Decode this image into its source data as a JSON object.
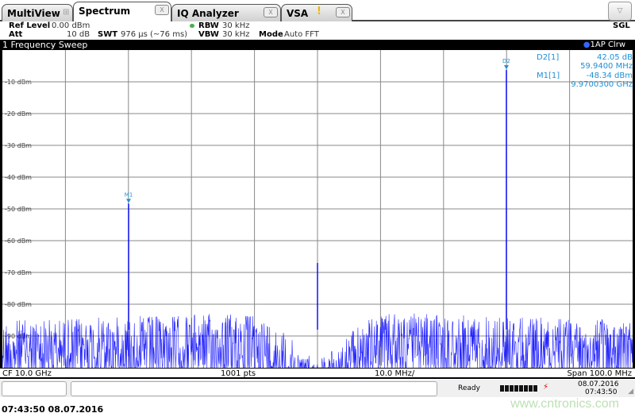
{
  "tabs": [
    {
      "label": "MultiView",
      "icon": "grid-icon"
    },
    {
      "label": "Spectrum",
      "close": "X",
      "active": true
    },
    {
      "label": "IQ Analyzer",
      "close": "X"
    },
    {
      "label": "VSA",
      "close": "X",
      "icon": "warning-icon"
    }
  ],
  "dropdown": "▽",
  "info": {
    "ref_level_label": "Ref Level",
    "ref_level": "0.00 dBm",
    "att_label": "Att",
    "att": "10 dB",
    "swt_label": "SWT",
    "swt": "976 µs (~76 ms)",
    "rbw_label": "RBW",
    "rbw": "30 kHz",
    "vbw_label": "VBW",
    "vbw": "30 kHz",
    "mode_label": "Mode",
    "mode": "Auto FFT",
    "sgl": "SGL"
  },
  "sweep_title": "1 Frequency Sweep",
  "trace_badge": "1AP Clrw",
  "marker_table": [
    {
      "name": "D2[1]",
      "v1": "42.05 dB",
      "v2": "59.9400 MHz"
    },
    {
      "name": "M1[1]",
      "v1": "-48.34 dBm",
      "v2": "9.9700300 GHz"
    }
  ],
  "footer": {
    "cf": "CF 10.0 GHz",
    "pts": "1001 pts",
    "div": "10.0 MHz/",
    "span": "Span 100.0 MHz"
  },
  "status": {
    "ready": "Ready",
    "date": "08.07.2016",
    "time": "07:43:50"
  },
  "bottom_timestamp": "07:43:50  08.07.2016",
  "watermark": "www.cntronics.com",
  "colors": {
    "trace": "#0000ff",
    "marker": "#1e8fd6",
    "grid": "#888888"
  },
  "chart_data": {
    "type": "line",
    "xlim_ghz": [
      9.95,
      10.05
    ],
    "ylim_dbm": [
      -100,
      0
    ],
    "y_ticks": [
      "-10 dBm",
      "-20 dBm",
      "-30 dBm",
      "-40 dBm",
      "-50 dBm",
      "-60 dBm",
      "-70 dBm",
      "-80 dBm",
      "-90 dBm"
    ],
    "grid": true,
    "peaks": [
      {
        "freq_ghz": 9.97003,
        "level_dbm": -48.34
      },
      {
        "freq_ghz": 10.0,
        "level_dbm": -67
      },
      {
        "freq_ghz": 10.02997,
        "level_dbm": -6.29
      }
    ],
    "markers": [
      {
        "label": "M1",
        "freq_ghz": 9.97003,
        "level_dbm": -48.34
      },
      {
        "label": "D2",
        "freq_ghz": 10.02997,
        "level_dbm": -6.29
      }
    ],
    "noise_floor_dbm": [
      -95,
      -78
    ]
  }
}
